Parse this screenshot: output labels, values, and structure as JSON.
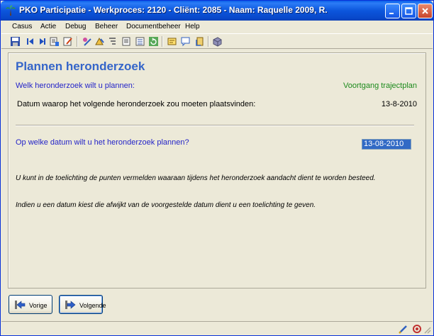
{
  "window": {
    "title": "PKO Participatie - Werkproces: 2120 - Cliënt: 2085 - Naam: Raquelle 2009, R."
  },
  "menu": [
    "Casus",
    "Actie",
    "Debug",
    "Beheer",
    "Documentbeheer",
    "Help"
  ],
  "toolbar_icons": [
    "save-icon",
    "first-record-icon",
    "previous-record-icon",
    "next-record-icon",
    "edit-icon",
    "edit-document-icon",
    "users-icon",
    "sort-icon",
    "filter-icon",
    "list-icon",
    "report-icon",
    "refresh-icon",
    "note-icon",
    "comment-icon",
    "attach-icon",
    "about-icon"
  ],
  "content": {
    "title": "Plannen heronderzoek",
    "question_which": "Welk heronderzoek wilt u plannen:",
    "progress_link": "Voortgang trajectplan",
    "date_label": "Datum waarop het volgende heronderzoek zou moeten plaatsvinden:",
    "date_value": "13-8-2010",
    "question_date": "Op welke datum wilt u het heronderzoek plannen?",
    "date_input_value": "13-08-2010",
    "note1": "U kunt in de toelichting de punten vermelden waaraan tijdens het heronderzoek aandacht dient te worden besteed.",
    "note2": "Indien u een datum kiest die afwijkt van de voorgestelde datum dient u een toelichting te geven."
  },
  "buttons": {
    "previous": "Vorige",
    "next": "Volgende"
  },
  "colors": {
    "title_blue": "#3565c9",
    "question_blue": "#2424c8",
    "link_green": "#1c8a1c",
    "selection": "#316ac5"
  }
}
